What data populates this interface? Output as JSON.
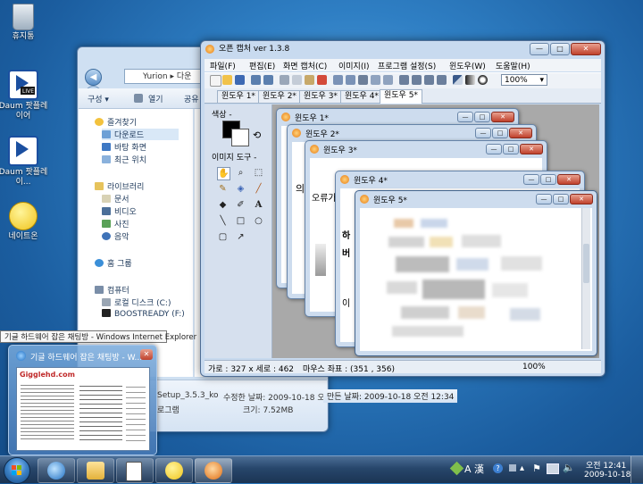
{
  "desktop": {
    "icons": [
      {
        "label": "휴지통"
      },
      {
        "label": "Daum 팟플레이어"
      },
      {
        "label": "Daum 팟플레이..."
      },
      {
        "label": "네이트온"
      }
    ]
  },
  "explorer": {
    "address": "Yurion ▸ 다운",
    "toolbar": {
      "organize": "구성 ▾",
      "open": "열기",
      "share": "공유"
    },
    "sidebar": {
      "favorites": "즐겨찾기",
      "downloads": "다운로드",
      "desktop": "바탕 화면",
      "recent": "최근 위치",
      "libraries": "라이브러리",
      "documents": "문서",
      "videos": "비디오",
      "pictures": "사진",
      "music": "음악",
      "homegroup": "홈 그룹",
      "computer": "컴퓨터",
      "local_disk": "로컬 디스크 (C:)",
      "boostready": "BOOSTREADY (F:)"
    },
    "details": {
      "filename": "Setup_3.5.3_ko",
      "modified": "수정한 날짜: 2009-10-18 오전 12:34",
      "created": "만든 날짜: 2009-10-18 오전 12:34",
      "type": "로그램",
      "size": "크기: 7.52MB"
    }
  },
  "opencapture": {
    "title": "오픈 캡처 ver 1.3.8",
    "menu": [
      "파일(F)",
      "편집(E)",
      "화면 캡처(C)",
      "이미지(I)",
      "프로그램 설정(S)",
      "윈도우(W)",
      "도움말(H)"
    ],
    "zoom": "100%",
    "tabs": [
      "윈도우 1*",
      "윈도우 2*",
      "윈도우 3*",
      "윈도우 4*",
      "윈도우 5*"
    ],
    "active_tab": "윈도우 5*",
    "left_panel": {
      "color_label": "색상 -",
      "tools_label": "이미지 도구 -"
    },
    "children": [
      {
        "title": "윈도우 1*"
      },
      {
        "title": "윈도우 2*"
      },
      {
        "title": "윈도우 3*"
      },
      {
        "title": "윈도우 4*"
      },
      {
        "title": "윈도우 5*"
      }
    ],
    "child_text": {
      "w2_line": "의",
      "w3_line1": "오류가 빈",
      "w3_line2": "",
      "w4_line1": "하",
      "w4_line2": "버",
      "w4_line3": "이"
    },
    "status": {
      "size": "가로 : 327 x 세로 : 462",
      "mouse": "마우스 좌표 : (351 ,  356)",
      "zoom": "100%"
    }
  },
  "thumbnail": {
    "tooltip": "기글 하드웨어 잡은 채팅방 - Windows Internet Explorer",
    "title": "기글 하드웨어 잡은 채팅방 - W...",
    "site_logo": "Gigglehd.com"
  },
  "taskbar": {
    "items": [
      "start",
      "internet-explorer",
      "windows-explorer",
      "solitaire",
      "nateon",
      "opencapture"
    ],
    "language": "A 漢",
    "time": "오전 12:41",
    "date": "2009-10-18"
  },
  "colors": {
    "accent": "#2f7fc4",
    "titlebar": "#c8daef",
    "close": "#c0412c"
  }
}
